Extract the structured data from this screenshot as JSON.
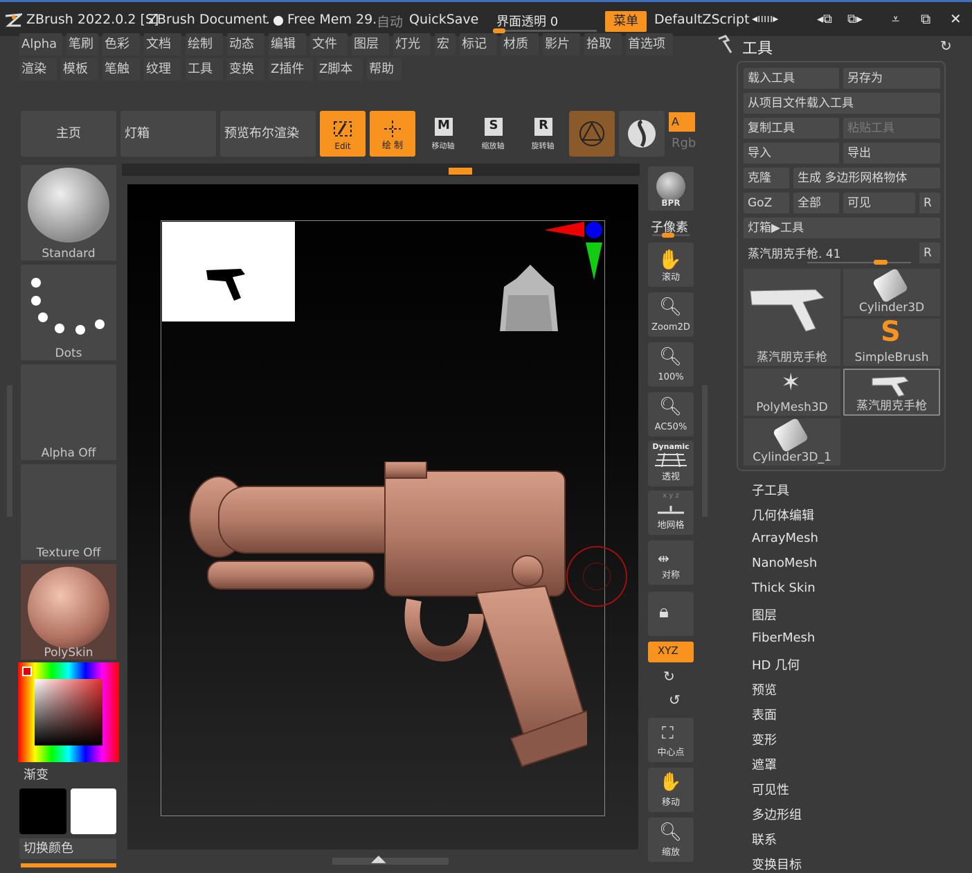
{
  "titlebar": {
    "app": "ZBrush 2022.0.2 [S]",
    "document": "ZBrush Document",
    "dot": ".",
    "mem": "Free Mem 29.",
    "auto": "自动",
    "quicksave": "QuickSave",
    "transparency": "界面透明 0",
    "menu_btn": "菜单",
    "script": "DefaultZScript",
    "ctrl1": "◂ııııı▸",
    "ctrl2": "◂ııııı▸"
  },
  "menus_row1": [
    "Alpha",
    "笔刷",
    "色彩",
    "文档",
    "绘制",
    "动态",
    "编辑",
    "文件",
    "图层",
    "灯光",
    "宏",
    "标记",
    "材质",
    "影片",
    "拾取",
    "首选项"
  ],
  "menus_row2": [
    "渲染",
    "模板",
    "笔触",
    "纹理",
    "工具",
    "变换",
    "Z插件",
    "Z脚本",
    "帮助"
  ],
  "shelf": {
    "home": "主页",
    "lightbox": "灯箱",
    "bpr": "预览布尔渲染",
    "edit": "Edit",
    "draw": "绘 制",
    "move": "移动轴",
    "scale": "缩放轴",
    "rotate": "旋转轴",
    "a_label": "A",
    "rgb": "Rgb"
  },
  "left_tiles": {
    "brush": "Standard",
    "stroke": "Dots",
    "alpha": "Alpha Off",
    "texture": "Texture Off",
    "material": "PolySkin",
    "gradient": "渐变",
    "switch_color": "切换颜色"
  },
  "vtoolbar": {
    "bpr": "BPR",
    "subpixel": "子像素",
    "scroll": "滚动",
    "zoom2d": "Zoom2D",
    "pct100": "100%",
    "ac50": "AC50%",
    "dynamic": "Dynamic",
    "persp": "透视",
    "floor": "地网格",
    "symm": "对称",
    "xyz": "XYZ",
    "center": "中心点",
    "move": "移动",
    "scale": "缩放"
  },
  "tool_panel": {
    "title": "工具",
    "load": "载入工具",
    "save_as": "另存为",
    "load_project": "从项目文件载入工具",
    "copy": "复制工具",
    "paste": "粘贴工具",
    "import": "导入",
    "export": "导出",
    "clone": "克隆",
    "make_polymesh": "生成 多边形网格物体",
    "goz": "GoZ",
    "all": "全部",
    "visible": "可见",
    "r": "R",
    "lightbox_tool": "灯箱▶工具",
    "current_tool": "蒸汽朋克手枪. 41",
    "thumbs": [
      "蒸汽朋克手枪",
      "Cylinder3D",
      "SimpleBrush",
      "PolyMesh3D",
      "蒸汽朋克手枪",
      "Cylinder3D_1"
    ]
  },
  "subpalettes": [
    "子工具",
    "几何体编辑",
    "ArrayMesh",
    "NanoMesh",
    "Thick Skin",
    "图层",
    "FiberMesh",
    "HD 几何",
    "预览",
    "表面",
    "变形",
    "遮罩",
    "可见性",
    "多边形组",
    "联系",
    "变换目标"
  ],
  "colors": {
    "accent": "#f7931e",
    "clay": "#c48a76"
  }
}
